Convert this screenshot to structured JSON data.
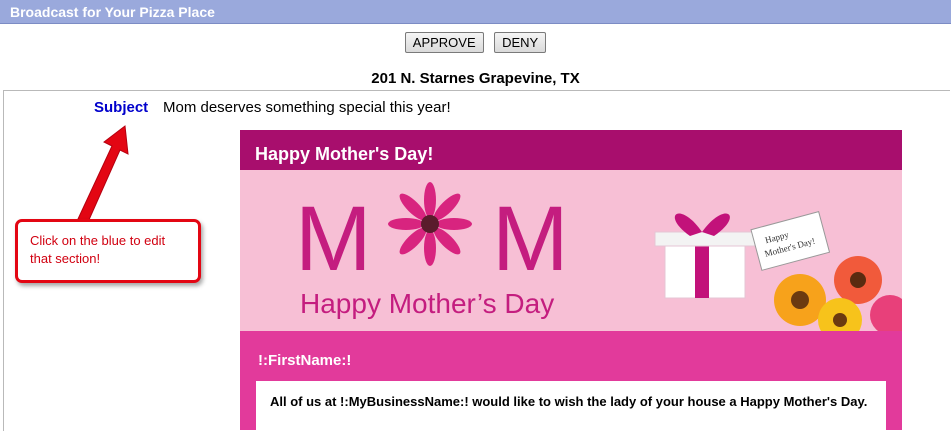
{
  "window": {
    "title": "Broadcast for Your Pizza Place"
  },
  "actions": {
    "approve_label": "APPROVE",
    "deny_label": "DENY"
  },
  "location": {
    "address": "201 N. Starnes Grapevine, TX"
  },
  "subject": {
    "label": "Subject",
    "value": "Mom deserves something special this year!"
  },
  "email": {
    "header": "Happy Mother's Day!",
    "banner_mom_left": "M",
    "banner_mom_right": "M",
    "banner_tagline": "Happy Mother’s Day",
    "tag_line1": "Happy",
    "tag_line2": "Mother's Day!",
    "greeting": "!:FirstName:!",
    "body_text": "All of us at !:MyBusinessName:! would like to wish the lady of your house a Happy Mother's Day."
  },
  "callout": {
    "text": "Click on the blue to edit that section!"
  },
  "colors": {
    "titlebar": "#9aa9dc",
    "email_header": "#a80e6d",
    "email_body": "#e23a9b",
    "banner": "#f7bfd5",
    "subject_link": "#0000cc",
    "callout_red": "#e30613"
  }
}
